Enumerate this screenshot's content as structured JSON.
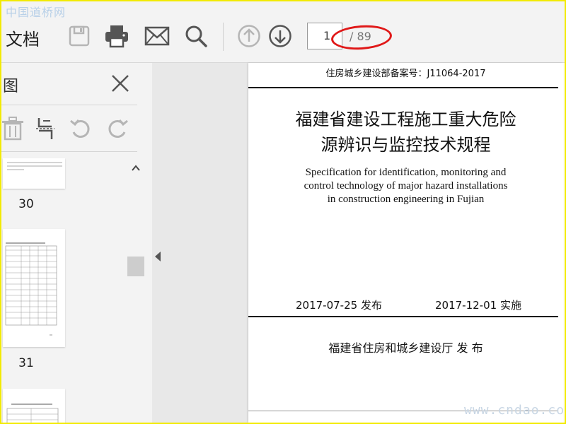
{
  "watermark_top": "中国道桥网",
  "watermark_bottom": "www.cndao.com",
  "toolbar": {
    "doc_label": "文档",
    "current_page": "1",
    "total_pages": "/ 89"
  },
  "icons": {
    "save": "save-icon",
    "print": "print-icon",
    "email": "email-icon",
    "search": "search-icon",
    "prev": "arrow-up-circle-icon",
    "next": "arrow-down-circle-icon"
  },
  "panel": {
    "title": "图",
    "thumbnails": [
      {
        "label": "30"
      },
      {
        "label": "31"
      }
    ]
  },
  "document": {
    "record_no": "住房城乡建设部备案号：J11064-2017",
    "title_line1": "福建省建设工程施工重大危险",
    "title_line2": "源辨识与监控技术规程",
    "en_line1": "Specification for identification, monitoring and",
    "en_line2": "control technology of major hazard installations",
    "en_line3": "in construction engineering in Fujian",
    "release_date": "2017-07-25 发布",
    "effective_date": "2017-12-01 实施",
    "publisher": "福建省住房和城乡建设厅 发 布"
  },
  "colors": {
    "highlight_ellipse": "#e01818",
    "frame": "#f2ea00"
  }
}
